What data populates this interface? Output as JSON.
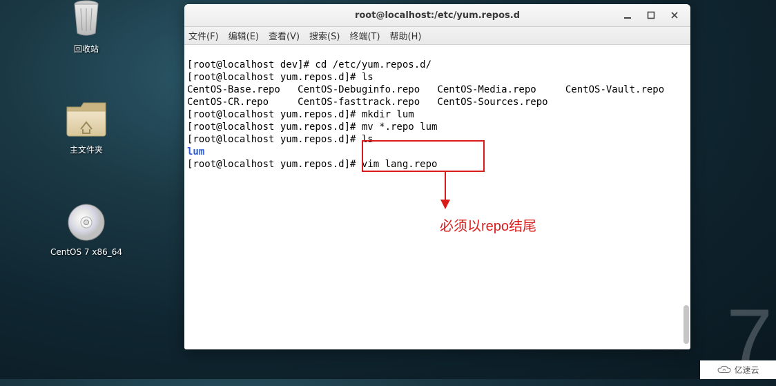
{
  "desktop": {
    "big_numeral": "7",
    "icons": {
      "trash": {
        "label": "回收站"
      },
      "home_folder": {
        "label": "主文件夹"
      },
      "disc": {
        "label": "CentOS 7 x86_64"
      }
    }
  },
  "window": {
    "title": "root@localhost:/etc/yum.repos.d",
    "menu": {
      "file": "文件(F)",
      "edit": "编辑(E)",
      "view": "查看(V)",
      "search": "搜索(S)",
      "terminal": "终端(T)",
      "help": "帮助(H)"
    },
    "terminal": {
      "l1": "[root@localhost dev]# cd /etc/yum.repos.d/",
      "l2": "[root@localhost yum.repos.d]# ls",
      "l3": "CentOS-Base.repo   CentOS-Debuginfo.repo   CentOS-Media.repo     CentOS-Vault.repo",
      "l4": "CentOS-CR.repo     CentOS-fasttrack.repo   CentOS-Sources.repo",
      "l5": "[root@localhost yum.repos.d]# mkdir lum",
      "l6": "[root@localhost yum.repos.d]# mv *.repo lum",
      "l7": "[root@localhost yum.repos.d]# ls",
      "l8_dir": "lum",
      "l9": "[root@localhost yum.repos.d]# vim lang.repo"
    }
  },
  "annotation": {
    "note": "必须以repo结尾"
  },
  "watermark": {
    "text": "亿速云"
  }
}
